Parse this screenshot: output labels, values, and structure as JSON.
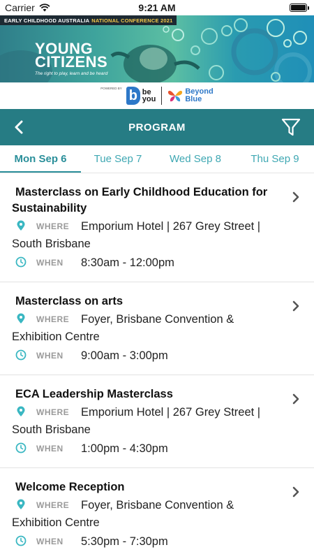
{
  "status_bar": {
    "carrier": "Carrier",
    "time": "9:21 AM"
  },
  "banner": {
    "strip_main": "EARLY CHILDHOOD AUSTRALIA",
    "strip_accent": "NATIONAL CONFERENCE 2021",
    "title_line1": "YOUNG",
    "title_line2": "CITIZENS",
    "tagline": "The right to play, learn and be heard"
  },
  "partners": {
    "powered_by": "POWERED BY",
    "beyou_letter": "b",
    "beyou_line1": "be",
    "beyou_line2": "you",
    "beyond_blue_line1": "Beyond",
    "beyond_blue_line2": "Blue"
  },
  "header": {
    "title": "PROGRAM"
  },
  "day_tabs": [
    {
      "label": "Mon Sep 6",
      "active": true
    },
    {
      "label": "Tue Sep 7",
      "active": false
    },
    {
      "label": "Wed Sep 8",
      "active": false
    },
    {
      "label": "Thu Sep 9",
      "active": false
    }
  ],
  "labels": {
    "where": "WHERE",
    "when": "WHEN"
  },
  "events": [
    {
      "title": "Masterclass on Early Childhood Education for Sustainability",
      "where": "Emporium Hotel | 267 Grey Street | South Brisbane",
      "when": "8:30am - 12:00pm"
    },
    {
      "title": "Masterclass on arts",
      "where": "Foyer, Brisbane Convention & Exhibition Centre",
      "when": "9:00am - 3:00pm"
    },
    {
      "title": "ECA Leadership Masterclass",
      "where": "Emporium Hotel | 267 Grey Street | South Brisbane",
      "when": "1:00pm - 4:30pm"
    },
    {
      "title": "Welcome Reception",
      "where": "Foyer, Brisbane Convention & Exhibition Centre",
      "when": "5:30pm - 7:30pm"
    }
  ],
  "colors": {
    "header_bg": "#267c84",
    "accent": "#2a8f9a",
    "icon_teal": "#3ab7c2"
  }
}
